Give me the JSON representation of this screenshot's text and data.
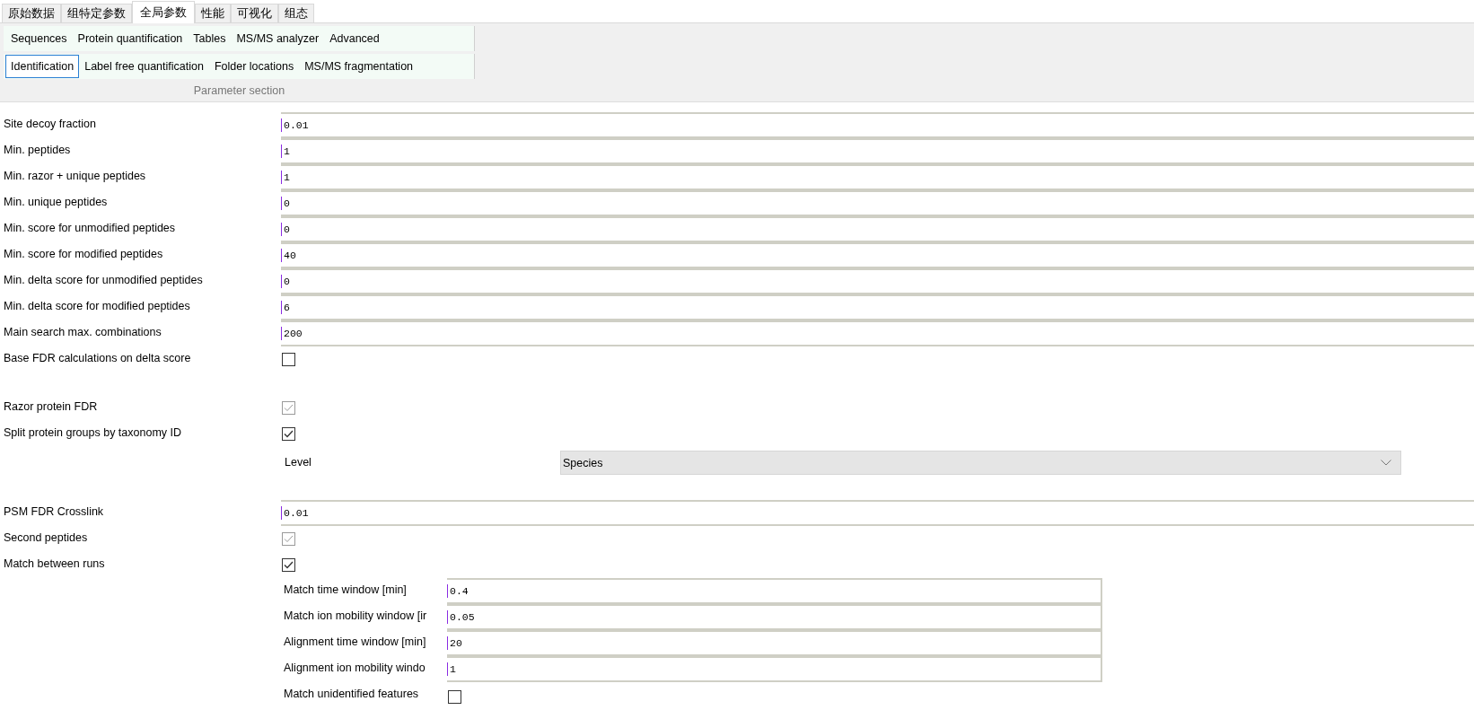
{
  "tabs": [
    {
      "label": "原始数据",
      "selected": false
    },
    {
      "label": "组特定参数",
      "selected": false
    },
    {
      "label": "全局参数",
      "selected": true
    },
    {
      "label": "性能",
      "selected": false
    },
    {
      "label": "可视化",
      "selected": false
    },
    {
      "label": "组态",
      "selected": false
    }
  ],
  "parameter_section": {
    "title": "Parameter section",
    "rows": [
      [
        {
          "label": "Sequences",
          "selected": false
        },
        {
          "label": "Protein quantification",
          "selected": false
        },
        {
          "label": "Tables",
          "selected": false
        },
        {
          "label": "MS/MS analyzer",
          "selected": false
        },
        {
          "label": "Advanced",
          "selected": false
        }
      ],
      [
        {
          "label": "Identification",
          "selected": true
        },
        {
          "label": "Label free quantification",
          "selected": false
        },
        {
          "label": "Folder locations",
          "selected": false
        },
        {
          "label": "MS/MS fragmentation",
          "selected": false
        }
      ]
    ]
  },
  "groups": [
    [
      {
        "kind": "text",
        "label": "Site decoy fraction",
        "value": "0.01"
      },
      {
        "kind": "text",
        "label": "Min. peptides",
        "value": "1"
      },
      {
        "kind": "text",
        "label": "Min. razor + unique peptides",
        "value": "1"
      },
      {
        "kind": "text",
        "label": "Min. unique peptides",
        "value": "0"
      },
      {
        "kind": "text",
        "label": "Min. score for unmodified peptides",
        "value": "0"
      },
      {
        "kind": "text",
        "label": "Min. score for modified peptides",
        "value": "40"
      },
      {
        "kind": "text",
        "label": "Min. delta score for unmodified peptides",
        "value": "0"
      },
      {
        "kind": "text",
        "label": "Min. delta score for modified peptides",
        "value": "6"
      },
      {
        "kind": "text",
        "label": "Main search max. combinations",
        "value": "200"
      },
      {
        "kind": "checkbox",
        "label": "Base FDR calculations on delta score",
        "checked": false,
        "disabled": false
      }
    ],
    [
      {
        "kind": "checkbox",
        "label": "Razor protein FDR",
        "checked": true,
        "disabled": true
      },
      {
        "kind": "checkbox",
        "label": "Split protein groups by taxonomy ID",
        "checked": true,
        "disabled": false,
        "children": [
          {
            "kind": "dropdown",
            "label": "Level",
            "value": "Species"
          }
        ]
      }
    ],
    [
      {
        "kind": "text",
        "label": "PSM FDR Crosslink",
        "value": "0.01"
      },
      {
        "kind": "checkbox",
        "label": "Second peptides",
        "checked": true,
        "disabled": true
      },
      {
        "kind": "checkbox",
        "label": "Match between runs",
        "checked": true,
        "disabled": false,
        "children": [
          {
            "kind": "text",
            "label": "Match time window [min]",
            "value": "0.4"
          },
          {
            "kind": "text",
            "label": "Match ion mobility window [ir",
            "value": "0.05"
          },
          {
            "kind": "text",
            "label": "Alignment time window [min]",
            "value": "20"
          },
          {
            "kind": "text",
            "label": "Alignment ion mobility windo",
            "value": "1"
          },
          {
            "kind": "checkbox",
            "label": "Match unidentified features",
            "checked": false,
            "disabled": false
          }
        ]
      }
    ]
  ]
}
